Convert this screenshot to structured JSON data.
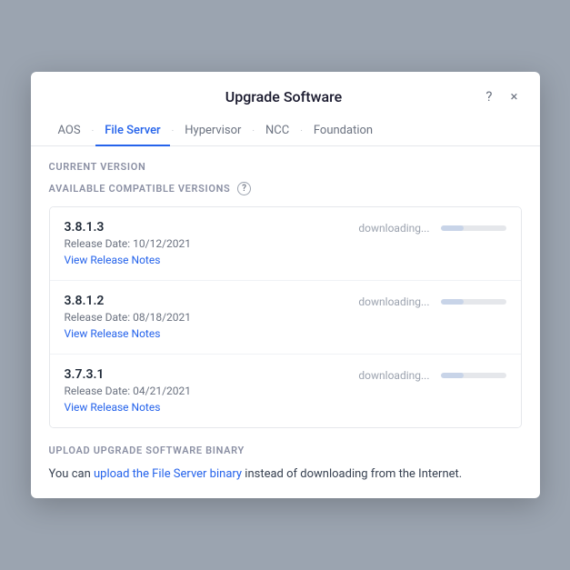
{
  "modal": {
    "title": "Upgrade Software",
    "help_icon": "?",
    "close_icon": "×"
  },
  "tabs": [
    {
      "label": "AOS",
      "active": false
    },
    {
      "label": "File Server",
      "active": true
    },
    {
      "label": "Hypervisor",
      "active": false
    },
    {
      "label": "NCC",
      "active": false
    },
    {
      "label": "Foundation",
      "active": false
    }
  ],
  "current_version_label": "CURRENT VERSION",
  "available_label": "AVAILABLE COMPATIBLE VERSIONS",
  "versions": [
    {
      "number": "3.8.1.3",
      "release_date": "Release Date: 10/12/2021",
      "status": "downloading...",
      "progress": 35,
      "notes_label": "View Release Notes"
    },
    {
      "number": "3.8.1.2",
      "release_date": "Release Date: 08/18/2021",
      "status": "downloading...",
      "progress": 35,
      "notes_label": "View Release Notes"
    },
    {
      "number": "3.7.3.1",
      "release_date": "Release Date: 04/21/2021",
      "status": "downloading...",
      "progress": 35,
      "notes_label": "View Release Notes"
    }
  ],
  "upload_section": {
    "label": "UPLOAD UPGRADE SOFTWARE BINARY",
    "text_before": "You can ",
    "link_text": "upload the File Server binary",
    "text_after": " instead of downloading from the Internet."
  }
}
